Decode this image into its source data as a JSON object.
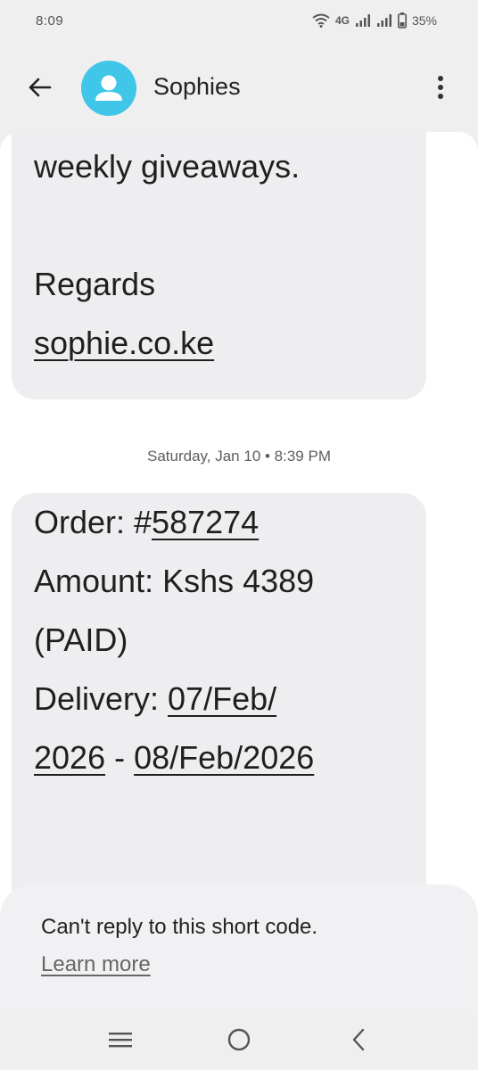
{
  "status_bar": {
    "time": "8:09",
    "network": "4G",
    "battery": "35%"
  },
  "header": {
    "contact_name": "Sophies",
    "back_icon": "arrow-left-icon",
    "avatar_icon": "person-icon",
    "more_icon": "more-vert-icon"
  },
  "messages": [
    {
      "lines": {
        "l1": "weekly giveaways.",
        "l2": "",
        "l3": "Regards",
        "l4": "sophie.co.ke"
      }
    },
    {
      "timestamp": "Saturday, Jan 10 • 8:39 PM",
      "order_label": "Order: #",
      "order_number": "587274",
      "amount": "Amount: Kshs 4389",
      "paid": "(PAID)",
      "delivery_label": "Delivery: ",
      "delivery_start_a": "07/Feb/",
      "delivery_start_b": "2026",
      "delivery_sep": " - ",
      "delivery_end": "08/Feb/2026"
    }
  ],
  "info_panel": {
    "text": "Can't reply to this short code.",
    "link": "Learn more"
  },
  "nav": {
    "recents_icon": "recents-icon",
    "home_icon": "home-icon",
    "back_icon": "back-icon"
  }
}
